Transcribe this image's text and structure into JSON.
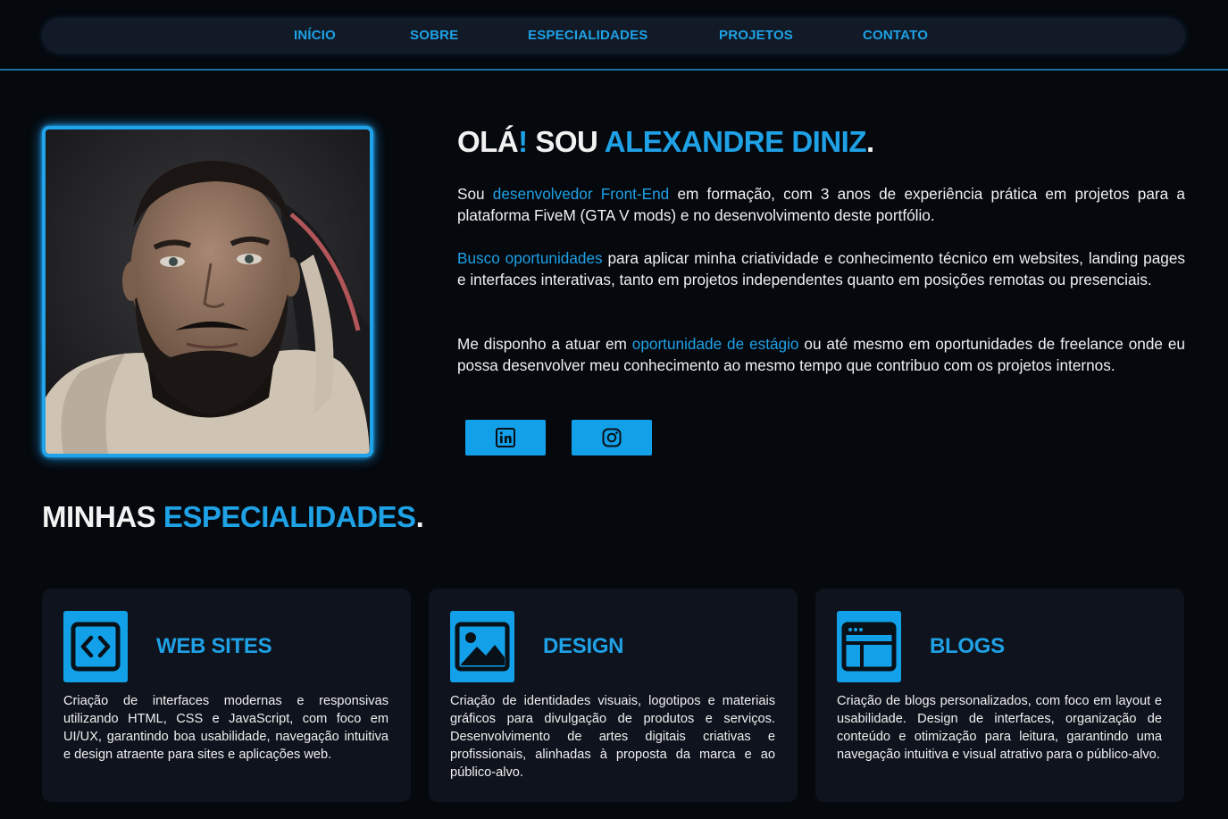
{
  "nav": {
    "items": [
      "INÍCIO",
      "SOBRE",
      "ESPECIALIDADES",
      "PROJETOS",
      "CONTATO"
    ]
  },
  "intro": {
    "title_part1": "OLÁ",
    "title_excl": "!",
    "title_part2": " SOU ",
    "title_name": "ALEXANDRE DINIZ",
    "title_dot": ".",
    "p1_a": "Sou ",
    "p1_hl": "desenvolvedor Front-End",
    "p1_b": " em formação, com 3 anos de experiência prática em projetos para a plataforma FiveM (GTA V mods) e no desenvolvimento deste portfólio.",
    "p2_hl": "Busco oportunidades",
    "p2_b": " para aplicar minha criatividade e conhecimento técnico em websites, landing pages e interfaces interativas, tanto em projetos independentes quanto em posições remotas ou presenciais.",
    "p3_a": "Me disponho a atuar em ",
    "p3_hl": "oportunidade de estágio",
    "p3_b": " ou até mesmo em oportunidades de freelance onde eu possa desenvolver meu conhecimento ao mesmo tempo que contribuo com os projetos internos."
  },
  "social": {
    "icons": [
      "linkedin-icon",
      "instagram-icon"
    ]
  },
  "specialties": {
    "title_part1": "MINHAS ",
    "title_hl": "ESPECIALIDADES",
    "title_dot": ".",
    "cards": [
      {
        "icon": "code-icon",
        "title": "WEB SITES",
        "text": "Criação de interfaces modernas e responsivas utilizando HTML, CSS e JavaScript, com foco em UI/UX, garantindo boa usabilidade, navegação intuitiva e design atraente para sites e aplicações web."
      },
      {
        "icon": "image-icon",
        "title": "DESIGN",
        "text": "Criação de identidades visuais, logotipos e materiais gráficos para divulgação de produtos e serviços. Desenvolvimento de artes digitais criativas e profissionais, alinhadas à proposta da marca e ao público-alvo."
      },
      {
        "icon": "browser-layout-icon",
        "title": "BLOGS",
        "text": "Criação de blogs personalizados, com foco em layout e usabilidade. Design de interfaces, organização de conteúdo e otimização para leitura, garantindo uma navegação intuitiva e visual atrativo para o público-alvo."
      }
    ]
  },
  "colors": {
    "accent": "#1fa1e6",
    "background": "#05080d",
    "card": "#0e131d",
    "nav": "#111a26"
  }
}
